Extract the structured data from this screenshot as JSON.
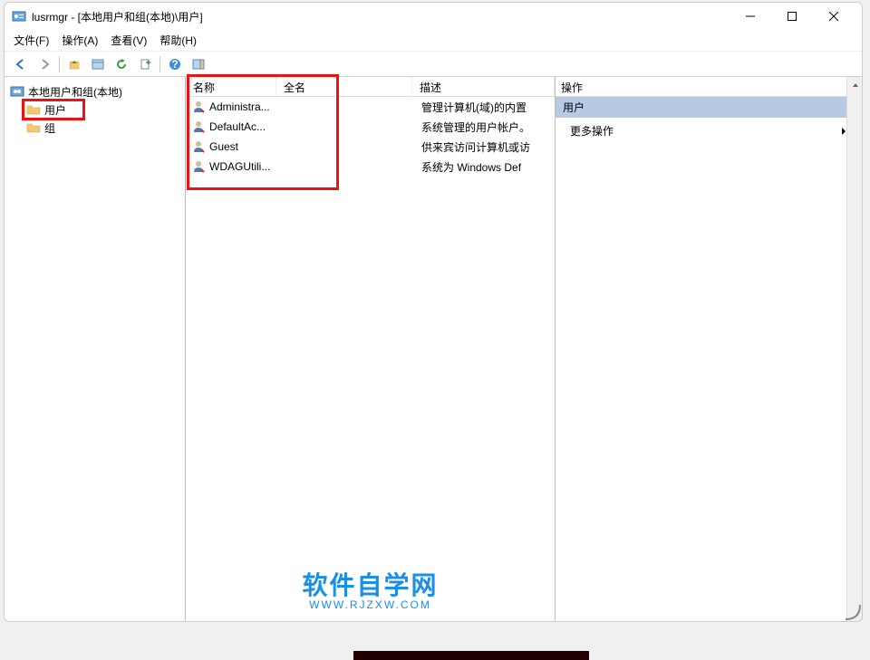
{
  "title": "lusrmgr - [本地用户和组(本地)\\用户]",
  "menus": {
    "file": "文件(F)",
    "action": "操作(A)",
    "view": "查看(V)",
    "help": "帮助(H)"
  },
  "tree": {
    "root": "本地用户和组(本地)",
    "users": "用户",
    "groups": "组"
  },
  "columns": {
    "name": "名称",
    "full": "全名",
    "desc": "描述"
  },
  "users": [
    {
      "name": "Administra...",
      "full": "",
      "desc": "管理计算机(域)的内置"
    },
    {
      "name": "DefaultAc...",
      "full": "",
      "desc": "系统管理的用户帐户。"
    },
    {
      "name": "Guest",
      "full": "",
      "desc": "供来宾访问计算机或访"
    },
    {
      "name": "WDAGUtili...",
      "full": "",
      "desc": "系统为 Windows Def"
    }
  ],
  "actions": {
    "header": "操作",
    "section": "用户",
    "more": "更多操作"
  },
  "watermark": {
    "line1": "软件自学网",
    "line2": "WWW.RJZXW.COM"
  }
}
